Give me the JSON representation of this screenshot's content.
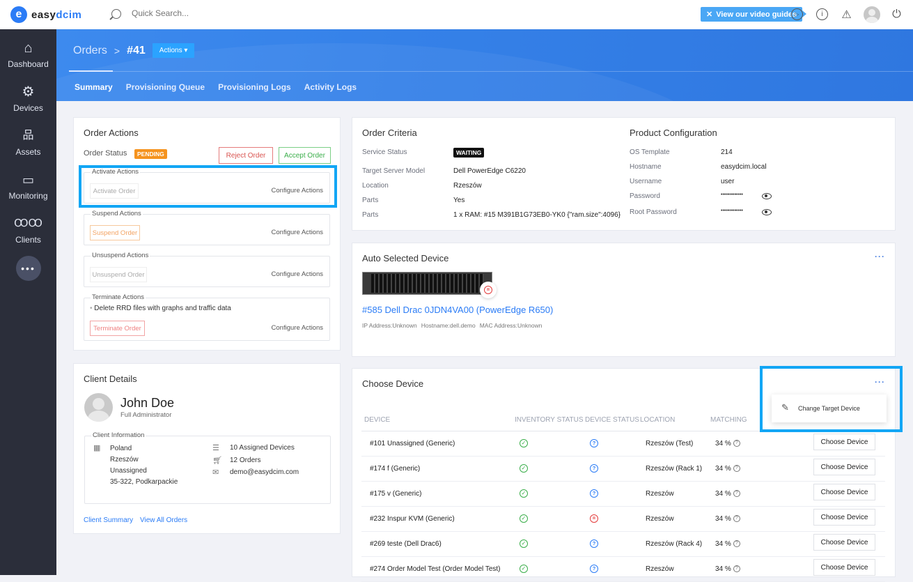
{
  "app": {
    "logo_mark": "e",
    "logo_text_a": "easy",
    "logo_text_b": "dcim",
    "search_placeholder": "Quick Search...",
    "video_guides_label": "View our video guides"
  },
  "sidebar": {
    "items": [
      {
        "label": "Dashboard",
        "icon": "home-icon"
      },
      {
        "label": "Devices",
        "icon": "gear-icon"
      },
      {
        "label": "Assets",
        "icon": "hierarchy-icon"
      },
      {
        "label": "Monitoring",
        "icon": "monitor-icon"
      },
      {
        "label": "Clients",
        "icon": "users-icon"
      }
    ],
    "more_label": "•••"
  },
  "header": {
    "breadcrumb_root": "Orders",
    "breadcrumb_sep": ">",
    "order_id": "#41",
    "actions_label": "Actions ▾",
    "tabs": [
      {
        "label": "Summary",
        "active": true
      },
      {
        "label": "Provisioning Queue"
      },
      {
        "label": "Provisioning Logs"
      },
      {
        "label": "Activity Logs"
      }
    ]
  },
  "order_actions": {
    "title": "Order Actions",
    "status_label": "Order Status",
    "status_badge": "PENDING",
    "reject_label": "Reject Order",
    "accept_label": "Accept Order",
    "configure_label": "Configure Actions",
    "groups": [
      {
        "legend": "Activate Actions",
        "button": "Activate Order"
      },
      {
        "legend": "Suspend Actions",
        "button": "Suspend Order"
      },
      {
        "legend": "Unsuspend Actions",
        "button": "Unsuspend Order"
      },
      {
        "legend": "Terminate Actions",
        "button": "Terminate Order",
        "note": "Delete RRD files with graphs and traffic data"
      }
    ]
  },
  "order_criteria": {
    "title": "Order Criteria",
    "rows": [
      {
        "label": "Service Status",
        "value": "WAITING"
      },
      {
        "label": "Target Server Model",
        "value": "Dell PowerEdge C6220"
      },
      {
        "label": "Location",
        "value": "Rzeszów"
      },
      {
        "label": "Parts",
        "value": "Yes"
      },
      {
        "label": "Parts",
        "value": "1 x RAM: #15 M391B1G73EB0-YK0 {\"ram.size\":4096}"
      }
    ]
  },
  "product_config": {
    "title": "Product Configuration",
    "rows": [
      {
        "label": "OS Template",
        "value": "214"
      },
      {
        "label": "Hostname",
        "value": "easydcim.local"
      },
      {
        "label": "Username",
        "value": "user"
      },
      {
        "label": "Password",
        "value": "•••••••••••••"
      },
      {
        "label": "Root Password",
        "value": "•••••••••••••"
      }
    ]
  },
  "auto_device": {
    "title": "Auto Selected Device",
    "more_label": "···",
    "device_link": "#585 Dell Drac 0JDN4VA00 (PowerEdge R650)",
    "ip": "IP Address:Unknown",
    "hostname": "Hostname:dell.demo",
    "mac": "MAC Address:Unknown"
  },
  "client": {
    "title": "Client Details",
    "name": "John Doe",
    "role": "Full Administrator",
    "info_legend": "Client Information",
    "address": [
      "Poland",
      "Rzeszów",
      "Unassigned",
      "35-322, Podkarpackie"
    ],
    "assigned_devices": "10 Assigned Devices",
    "orders": "12 Orders",
    "email": "demo@easydcim.com",
    "summary_link": "Client Summary",
    "orders_link": "View All Orders"
  },
  "choose_device": {
    "title": "Choose Device",
    "more_label": "···",
    "menu_item": "Change Target Device",
    "columns": [
      "DEVICE",
      "INVENTORY STATUS",
      "DEVICE STATUS",
      "LOCATION",
      "MATCHING"
    ],
    "button_label": "Choose Device",
    "rows": [
      {
        "device": "#101 Unassigned (Generic)",
        "inventory": "ok",
        "status": "unknown",
        "location": "Rzeszów (Test)",
        "matching": "34 %"
      },
      {
        "device": "#174 f (Generic)",
        "inventory": "ok",
        "status": "unknown",
        "location": "Rzeszów (Rack 1)",
        "matching": "34 %"
      },
      {
        "device": "#175 v (Generic)",
        "inventory": "ok",
        "status": "unknown",
        "location": "Rzeszów",
        "matching": "34 %"
      },
      {
        "device": "#232 Inspur KVM (Generic)",
        "inventory": "ok",
        "status": "paused",
        "location": "Rzeszów",
        "matching": "34 %"
      },
      {
        "device": "#269 teste (Dell Drac6)",
        "inventory": "ok",
        "status": "unknown",
        "location": "Rzeszów (Rack 4)",
        "matching": "34 %"
      },
      {
        "device": "#274 Order Model Test (Order Model Test)",
        "inventory": "ok",
        "status": "unknown",
        "location": "Rzeszów",
        "matching": "34 %"
      }
    ]
  },
  "colors": {
    "accent": "#2b7cf6",
    "pending": "#f5931e",
    "highlight": "#12a6f5",
    "danger": "#e33b3b",
    "success": "#3aae4a"
  }
}
